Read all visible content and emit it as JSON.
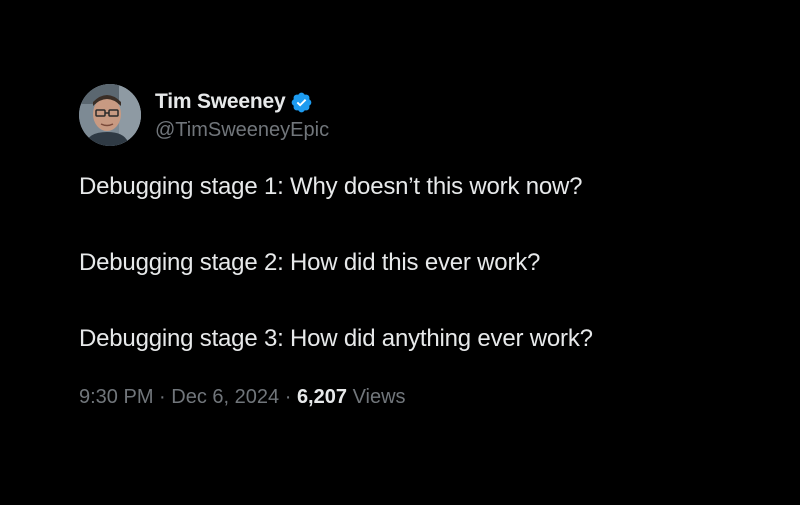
{
  "author": {
    "display_name": "Tim Sweeney",
    "handle": "@TimSweeneyEpic",
    "verified_color": "#1d9bf0"
  },
  "tweet": {
    "lines": [
      "Debugging stage 1: Why doesn’t this work now?",
      "Debugging stage 2: How did this ever work?",
      "Debugging stage 3: How did anything ever work?"
    ],
    "time": "9:30 PM",
    "separator": "·",
    "date": "Dec 6, 2024",
    "views_count": "6,207",
    "views_label": "Views"
  },
  "colors": {
    "background": "#000000",
    "primary_text": "#e7e9ea",
    "secondary_text": "#71767b"
  }
}
